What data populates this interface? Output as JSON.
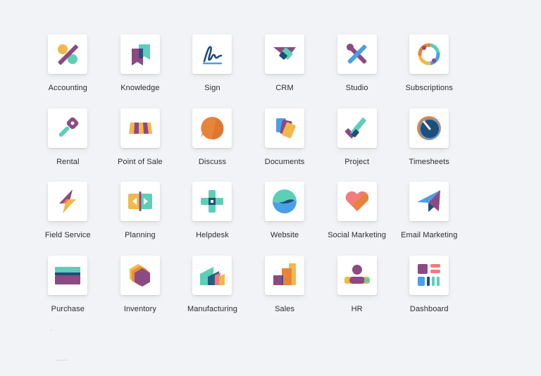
{
  "colors": {
    "background": "#f2f3f6",
    "tile": "#ffffff",
    "label": "#2b2b33",
    "purple": "#8b4a84",
    "teal": "#5ccfb7",
    "yellow": "#f2b84b",
    "orange": "#e8833a",
    "blue": "#4aa0e6",
    "navy": "#1f4e79"
  },
  "apps": [
    {
      "label": "Accounting",
      "icon": "accounting-icon"
    },
    {
      "label": "Knowledge",
      "icon": "knowledge-icon"
    },
    {
      "label": "Sign",
      "icon": "sign-icon"
    },
    {
      "label": "CRM",
      "icon": "crm-icon"
    },
    {
      "label": "Studio",
      "icon": "studio-icon"
    },
    {
      "label": "Subscriptions",
      "icon": "subscriptions-icon"
    },
    {
      "label": "Rental",
      "icon": "rental-icon"
    },
    {
      "label": "Point of Sale",
      "icon": "point-of-sale-icon"
    },
    {
      "label": "Discuss",
      "icon": "discuss-icon"
    },
    {
      "label": "Documents",
      "icon": "documents-icon"
    },
    {
      "label": "Project",
      "icon": "project-icon"
    },
    {
      "label": "Timesheets",
      "icon": "timesheets-icon"
    },
    {
      "label": "Field Service",
      "icon": "field-service-icon"
    },
    {
      "label": "Planning",
      "icon": "planning-icon"
    },
    {
      "label": "Helpdesk",
      "icon": "helpdesk-icon"
    },
    {
      "label": "Website",
      "icon": "website-icon"
    },
    {
      "label": "Social Marketing",
      "icon": "social-marketing-icon"
    },
    {
      "label": "Email Marketing",
      "icon": "email-marketing-icon"
    },
    {
      "label": "Purchase",
      "icon": "purchase-icon"
    },
    {
      "label": "Inventory",
      "icon": "inventory-icon"
    },
    {
      "label": "Manufacturing",
      "icon": "manufacturing-icon"
    },
    {
      "label": "Sales",
      "icon": "sales-icon"
    },
    {
      "label": "HR",
      "icon": "hr-icon"
    },
    {
      "label": "Dashboard",
      "icon": "dashboard-icon"
    }
  ]
}
